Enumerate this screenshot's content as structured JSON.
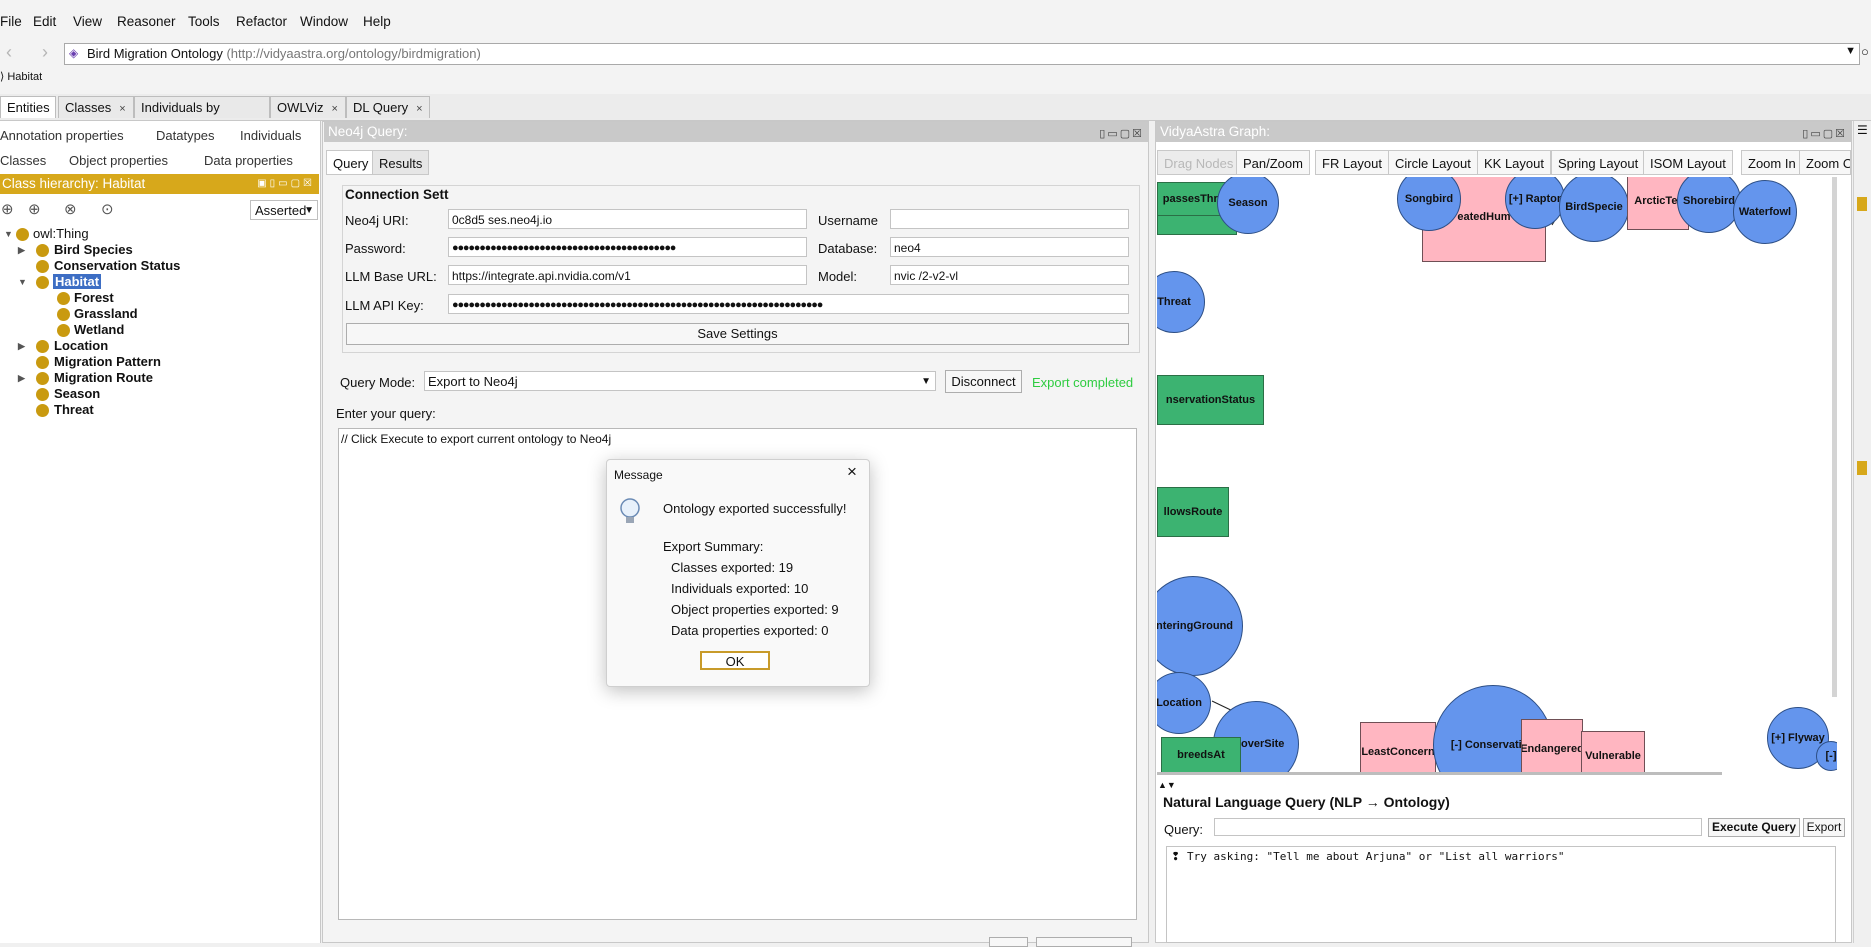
{
  "menu": [
    "File",
    "Edit",
    "View",
    "Reasoner",
    "Tools",
    "Refactor",
    "Window",
    "Help"
  ],
  "address": {
    "ontology_name": "Bird Migration Ontology",
    "ontology_iri": "(http://vidyaastra.org/ontology/birdmigration)",
    "breadcrumb": "Habitat"
  },
  "tabs": [
    {
      "label": "Entities",
      "active": true
    },
    {
      "label": "Classes"
    },
    {
      "label": "Individuals by class"
    },
    {
      "label": "OWLViz"
    },
    {
      "label": "DL Query"
    }
  ],
  "left": {
    "subtabs_row1": [
      "Annotation properties",
      "Datatypes",
      "Individuals"
    ],
    "subtabs_row2": [
      "Classes",
      "Object properties",
      "Data properties"
    ],
    "hierarchy_title": "Class hierarchy: Habitat",
    "asserted": "Asserted",
    "tree": [
      {
        "label": "owl:Thing",
        "level": 0,
        "expanded": true,
        "bold": false
      },
      {
        "label": "Bird Species",
        "level": 1,
        "collapsed": true
      },
      {
        "label": "Conservation Status",
        "level": 1
      },
      {
        "label": "Habitat",
        "level": 1,
        "expanded": true,
        "selected": true
      },
      {
        "label": "Forest",
        "level": 2
      },
      {
        "label": "Grassland",
        "level": 2
      },
      {
        "label": "Wetland",
        "level": 2
      },
      {
        "label": "Location",
        "level": 1,
        "collapsed": true
      },
      {
        "label": "Migration Pattern",
        "level": 1
      },
      {
        "label": "Migration Route",
        "level": 1,
        "collapsed": true
      },
      {
        "label": "Season",
        "level": 1
      },
      {
        "label": "Threat",
        "level": 1
      }
    ]
  },
  "center": {
    "title": "Neo4j Query:",
    "tabs": [
      "Query",
      "Results"
    ],
    "connection_title": "Connection Sett",
    "fields": {
      "uri_label": "Neo4j URI:",
      "uri_value": "          0c8d5    ses.neo4j.io",
      "username_label": "Username",
      "password_label": "Password:",
      "password_value": "●●●●●●●●●●●●●●●●●●●●●●●●●●●●●●●●●●●●●●●●●",
      "database_label": "Database:",
      "database_value": "neo4",
      "llm_base_label": "LLM Base URL:",
      "llm_base_value": "https://integrate.api.nvidia.com/v1",
      "model_label": "Model:",
      "model_value": "nvic                            /2-v2-vl",
      "llm_key_label": "LLM API Key:",
      "llm_key_value": "●●●●●●●●●●●●●●●●●●●●●●●●●●●●●●●●●●●●●●●●●●●●●●●●●●●●●●●●●●●●●●●●●●●●"
    },
    "save_button": "Save Settings",
    "query_mode_label": "Query Mode:",
    "query_mode_value": "Export to Neo4j",
    "disconnect_button": "Disconnect",
    "status": "Export completed",
    "enter_query_label": "Enter your query:",
    "query_text": "// Click Execute to export current ontology to Neo4j"
  },
  "dialog": {
    "title": "Message",
    "headline": "Ontology exported successfully!",
    "summary_title": "Export Summary:",
    "lines": [
      "Classes exported: 19",
      "Individuals exported: 10",
      "Object properties exported: 9",
      "Data properties exported: 0"
    ],
    "ok": "OK"
  },
  "right": {
    "title": "VidyaAstra Graph:",
    "toolbar": [
      "Drag Nodes",
      "Pan/Zoom",
      "FR Layout",
      "Circle Layout",
      "KK Layout",
      "Spring Layout",
      "ISOM Layout",
      "Zoom In",
      "Zoom O"
    ],
    "nodes": [
      "passesThrou",
      "Season",
      "Songbird",
      "eatedHum",
      "[+] Raptor",
      "BirdSpecie",
      "ArcticTer",
      "Shorebird",
      "Waterfowl",
      "Threat",
      "nservationStatus",
      "llowsRoute",
      "interingGround",
      "Location",
      "opoverSite",
      "breedsAt",
      "LeastConcern",
      "[-] Conservation",
      "Endangered",
      "Vulnerable",
      "[+] Flyway",
      "[-]"
    ],
    "nlq_title": "Natural Language Query (NLP → Ontology)",
    "nlq_query_label": "Query:",
    "execute_button": "Execute Query",
    "export_button": "Export",
    "hint": "Try asking: \"Tell me about Arjuna\" or \"List all warriors\""
  },
  "colors": {
    "class_node": "#6495ed",
    "property_node": "#3cb371",
    "individual_node": "#ffb6c1",
    "hierarchy_header": "#d7a81b",
    "status_ok": "#2ecc40"
  }
}
